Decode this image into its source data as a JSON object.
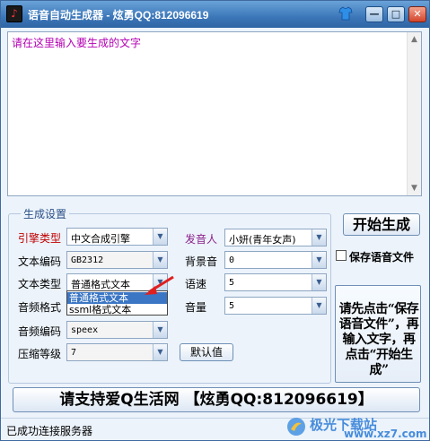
{
  "window": {
    "title": "语音自动生成器 - 炫勇QQ:812096619",
    "app_icon_glyph": "♪",
    "controls": {
      "minimize": "—",
      "maximize": "□",
      "close": "✕"
    },
    "skin_icon": "shirt-icon"
  },
  "input": {
    "placeholder_text": "请在这里输入要生成的文字"
  },
  "settings": {
    "group_title": "生成设置",
    "engine": {
      "label": "引擎类型",
      "value": "中文合成引擎"
    },
    "encoding": {
      "label": "文本编码",
      "value": "GB2312"
    },
    "text_type": {
      "label": "文本类型",
      "value": "普通格式文本",
      "options": [
        "普通格式文本",
        "ssml格式文本"
      ]
    },
    "audio_format": {
      "label": "音频格式"
    },
    "audio_encoding": {
      "label": "音频编码",
      "value": "speex"
    },
    "compression": {
      "label": "压缩等级",
      "value": "7"
    },
    "speaker": {
      "label": "发音人",
      "value": "小妍(青年女声)"
    },
    "bg_sound": {
      "label": "背景音",
      "value": "0"
    },
    "speed": {
      "label": "语速",
      "value": "5"
    },
    "volume": {
      "label": "音量",
      "value": "5"
    },
    "default_button": "默认值"
  },
  "actions": {
    "start_button": "开始生成",
    "save_checkbox_label": "保存语音文件",
    "save_checked": false,
    "instructions": "请先点击“保存语音文件”，再输入文字，再点击“开始生成”"
  },
  "banner": "请支持爱Q生活网 【炫勇QQ:812096619】",
  "status": "已成功连接服务器",
  "watermark": {
    "brand": "极光下载站",
    "url": "www.xz7.com"
  },
  "colors": {
    "titlebar": "#3c77b9",
    "engine_label": "#c00000",
    "speaker_label": "#8a1f8a",
    "placeholder": "#b300b3",
    "dropdown_selected": "#3b76c4"
  }
}
